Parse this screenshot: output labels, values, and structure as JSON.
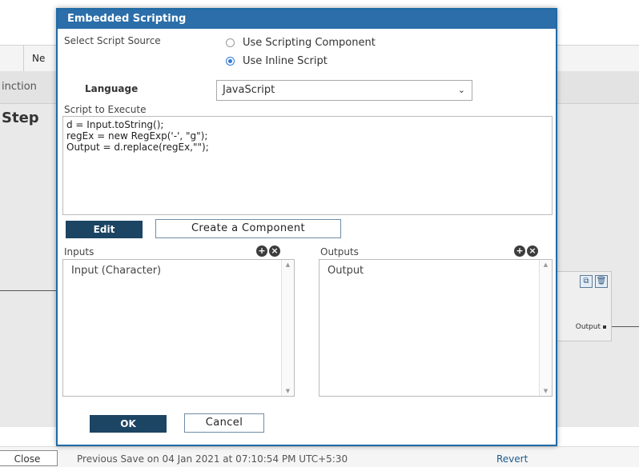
{
  "background": {
    "tabs": [
      {
        "label": "Ne"
      }
    ],
    "subheader_text": "inction",
    "steps_heading": "Step",
    "node": {
      "icons": [
        "copy-icon",
        "trash-icon"
      ],
      "output_label": "Output"
    },
    "footer": {
      "close_label": "Close",
      "save_status": "Previous Save on 04 Jan 2021 at 07:10:54 PM UTC+5:30",
      "revert_label": "Revert"
    }
  },
  "dialog": {
    "title": "Embedded Scripting",
    "select_source_label": "Select Script Source",
    "source_options": [
      {
        "label": "Use Scripting Component",
        "selected": false
      },
      {
        "label": "Use Inline Script",
        "selected": true
      }
    ],
    "language_label": "Language",
    "language_value": "JavaScript",
    "script_label": "Script to Execute",
    "script_code": "d = Input.toString();\nregEx = new RegExp('-', \"g\");\nOutput = d.replace(regEx,\"\");",
    "edit_label": "Edit",
    "create_component_label": "Create a Component",
    "inputs_label": "Inputs",
    "inputs_items": [
      "Input (Character)"
    ],
    "outputs_label": "Outputs",
    "outputs_items": [
      "Output"
    ],
    "ok_label": "OK",
    "cancel_label": "Cancel"
  },
  "colors": {
    "title_bar": "#2b6ea9",
    "primary_button": "#1c4463",
    "radio_accent": "#2f7bd8"
  }
}
